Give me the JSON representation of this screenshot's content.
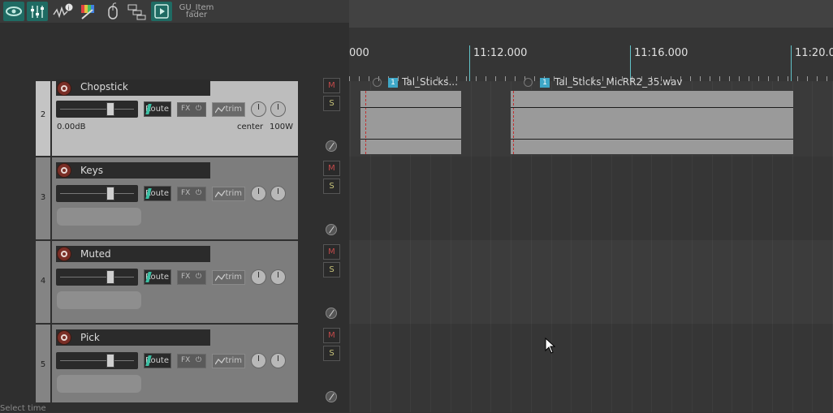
{
  "toolbar": {
    "items": [
      "show-item-icon",
      "mixer-icon",
      "envelope-info-icon",
      "color-icon",
      "mouse-icon",
      "window-layout-icon",
      "play-region-icon"
    ],
    "label_line1": "GU_Item",
    "label_line2": "fader"
  },
  "ruler": {
    "labels": [
      "000",
      "11:12.000",
      "11:16.000",
      "11:20.0"
    ]
  },
  "tracks": [
    {
      "num": "2",
      "name": "Chopstick",
      "volume": "0.00dB",
      "pan": "center",
      "width": "100W",
      "selected": true
    },
    {
      "num": "3",
      "name": "Keys",
      "selected": false
    },
    {
      "num": "4",
      "name": "Muted",
      "selected": false
    },
    {
      "num": "5",
      "name": "Pick",
      "selected": false
    }
  ],
  "buttons": {
    "route": "Route",
    "fx": "FX",
    "trim": "trim",
    "mute": "M",
    "solo": "S"
  },
  "items": [
    {
      "take": "1",
      "name": "Tal_Sticks..."
    },
    {
      "take": "1",
      "name": "Tal_Sticks_MicRR2_35.wav"
    }
  ],
  "status": {
    "text": "Select time"
  },
  "colors": {
    "accent": "#1f6b63",
    "ruler_major": "#62c2c8",
    "route_stripe": "#3bbfa3",
    "mute": "#c24a4a",
    "solo": "#c9c47a"
  }
}
